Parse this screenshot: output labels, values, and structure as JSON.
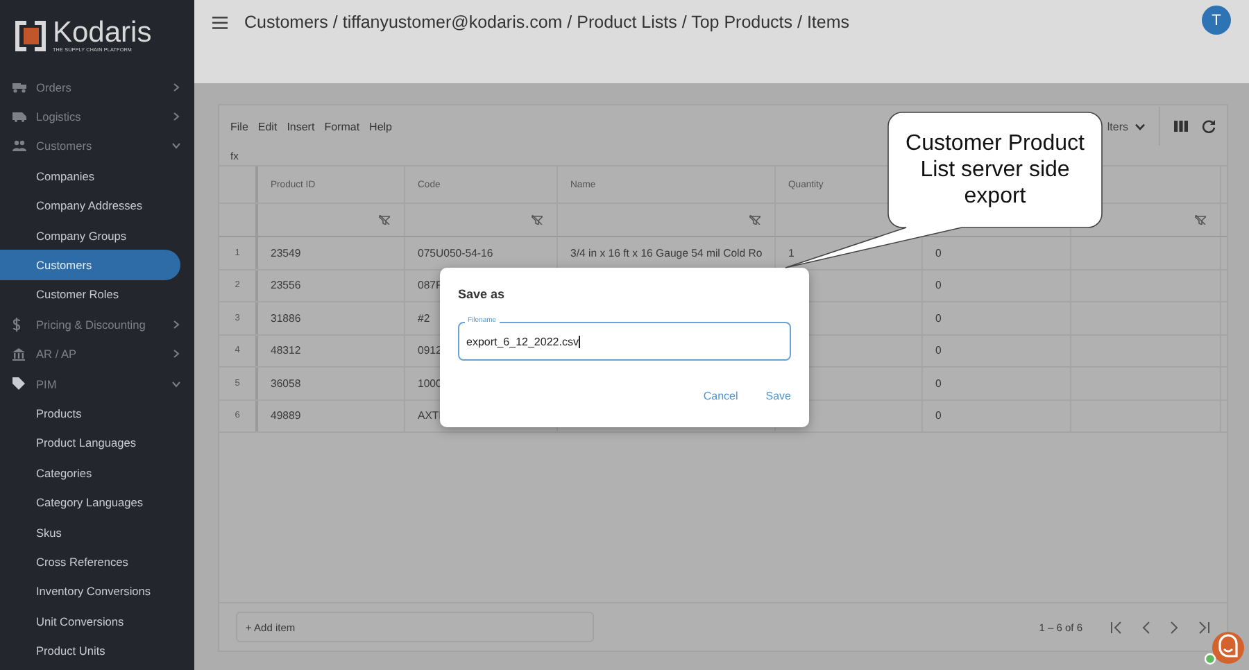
{
  "sidebar": {
    "logo": {
      "name": "Kodaris",
      "tagline": "THE SUPPLY CHAIN PLATFORM"
    },
    "items": [
      {
        "label": "Orders",
        "expanded": false
      },
      {
        "label": "Logistics",
        "expanded": false
      },
      {
        "label": "Customers",
        "expanded": true,
        "children": [
          {
            "label": "Companies",
            "selected": false
          },
          {
            "label": "Company Addresses",
            "selected": false
          },
          {
            "label": "Company Groups",
            "selected": false
          },
          {
            "label": "Customers",
            "selected": true
          },
          {
            "label": "Customer Roles",
            "selected": false
          }
        ]
      },
      {
        "label": "Pricing & Discounting",
        "expanded": false
      },
      {
        "label": "AR / AP",
        "expanded": false
      },
      {
        "label": "PIM",
        "expanded": true,
        "children": [
          {
            "label": "Products",
            "selected": false
          },
          {
            "label": "Product Languages",
            "selected": false
          },
          {
            "label": "Categories",
            "selected": false
          },
          {
            "label": "Category Languages",
            "selected": false
          },
          {
            "label": "Skus",
            "selected": false
          },
          {
            "label": "Cross References",
            "selected": false
          },
          {
            "label": "Inventory Conversions",
            "selected": false
          },
          {
            "label": "Unit Conversions",
            "selected": false
          },
          {
            "label": "Product Units",
            "selected": false
          }
        ]
      }
    ]
  },
  "header": {
    "breadcrumb": "Customers / tiffanyustomer@kodaris.com / Product Lists / Top Products / Items",
    "avatar": "T"
  },
  "grid": {
    "menu": [
      "File",
      "Edit",
      "Insert",
      "Format",
      "Help"
    ],
    "filters_label": "lters",
    "formula_label": "fx",
    "columns": [
      {
        "title": "Product ID",
        "filter": true
      },
      {
        "title": "Code",
        "filter": true
      },
      {
        "title": "Name",
        "filter": true
      },
      {
        "title": "Quantity"
      },
      {},
      {
        "filter": true
      }
    ],
    "rows": [
      {
        "number": "1",
        "cells": [
          "23549",
          "075U050-54-16",
          "3/4 in x 16 ft x 16 Gauge 54 mil Cold Ro",
          "1",
          "0"
        ]
      },
      {
        "number": "2",
        "cells": [
          "23556",
          "087F",
          null,
          null,
          "0"
        ]
      },
      {
        "number": "3",
        "cells": [
          "31886",
          "#2",
          null,
          null,
          "0"
        ]
      },
      {
        "number": "4",
        "cells": [
          "48312",
          "0912",
          null,
          null,
          "0"
        ]
      },
      {
        "number": "5",
        "cells": [
          "36058",
          "1000",
          null,
          null,
          "0"
        ]
      },
      {
        "number": "6",
        "cells": [
          "49889",
          "AXTI",
          null,
          null,
          "0"
        ]
      }
    ],
    "add_item": "+ Add item",
    "range": "1 – 6 of 6"
  },
  "dialog": {
    "title": "Save as",
    "field": {
      "label": "Filename",
      "value": "export_6_12_2022.csv"
    },
    "buttons": [
      "Cancel",
      "Save"
    ]
  },
  "callout": {
    "text": "Customer Product List server side export"
  }
}
